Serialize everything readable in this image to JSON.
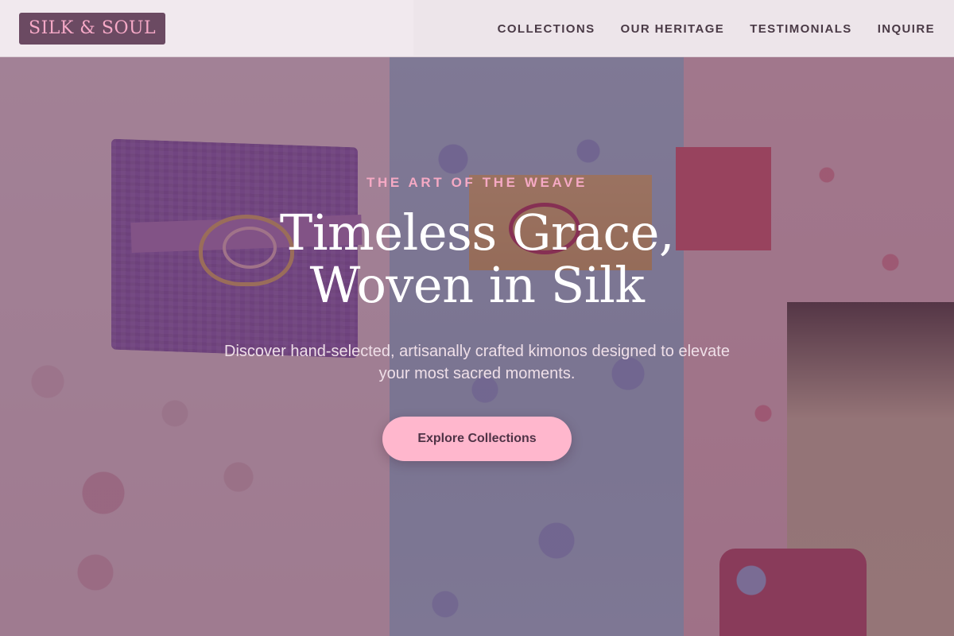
{
  "brand": {
    "logo_text": "SILK & SOUL"
  },
  "nav": {
    "items": [
      {
        "label": "COLLECTIONS"
      },
      {
        "label": "OUR HERITAGE"
      },
      {
        "label": "TESTIMONIALS"
      },
      {
        "label": "INQUIRE"
      }
    ]
  },
  "hero": {
    "eyebrow": "THE ART OF THE WEAVE",
    "headline_line1": "Timeless Grace,",
    "headline_line2": "Woven in Silk",
    "subtitle": "Discover hand-selected, artisanally crafted kimonos designed to elevate your most sacred moments.",
    "cta_label": "Explore Collections"
  },
  "colors": {
    "accent_pink": "#ffb7cd",
    "logo_background": "#6b4a62",
    "logo_text": "#f6a9c7",
    "overlay": "#5c304e"
  }
}
